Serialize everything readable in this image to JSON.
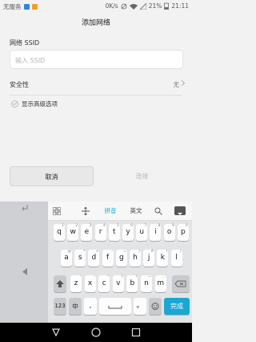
{
  "status": {
    "carrier": "无服务",
    "speed": "0K/s",
    "battery": "21%",
    "time": "21:11",
    "icons": [
      "sim-icon",
      "notification-icon",
      "mute-icon",
      "wifi-icon",
      "no-signal-icon",
      "battery-icon"
    ]
  },
  "page": {
    "title": "添加网络"
  },
  "ssid": {
    "label": "网络 SSID",
    "placeholder": "输入 SSID",
    "value": ""
  },
  "security": {
    "label": "安全性",
    "value": "无"
  },
  "advanced": {
    "label": "显示高级选项"
  },
  "buttons": {
    "cancel": "取消",
    "connect": "连接"
  },
  "keyboard": {
    "toolbar": {
      "pinyin": "拼音",
      "english": "英文"
    },
    "row1": [
      {
        "k": "q",
        "s": "1"
      },
      {
        "k": "w",
        "s": "2"
      },
      {
        "k": "e",
        "s": "3"
      },
      {
        "k": "r",
        "s": "4"
      },
      {
        "k": "t",
        "s": "5"
      },
      {
        "k": "y",
        "s": "6"
      },
      {
        "k": "u",
        "s": "7"
      },
      {
        "k": "i",
        "s": "8"
      },
      {
        "k": "o",
        "s": "9"
      },
      {
        "k": "p",
        "s": "0"
      }
    ],
    "row2": [
      {
        "k": "a",
        "s": "@"
      },
      {
        "k": "s",
        "s": "*"
      },
      {
        "k": "d",
        "s": "+"
      },
      {
        "k": "f",
        "s": "-"
      },
      {
        "k": "g",
        "s": "="
      },
      {
        "k": "h",
        "s": "/"
      },
      {
        "k": "j",
        "s": "#"
      },
      {
        "k": "k",
        "s": "("
      },
      {
        "k": "l",
        "s": ")"
      }
    ],
    "row3": [
      {
        "k": "z",
        "s": "'"
      },
      {
        "k": "x",
        "s": ":"
      },
      {
        "k": "c",
        "s": "\""
      },
      {
        "k": "v",
        "s": "?"
      },
      {
        "k": "b",
        "s": "!"
      },
      {
        "k": "n",
        "s": "~"
      },
      {
        "k": "m",
        "s": "…"
      }
    ],
    "bottom": {
      "num": "123",
      "lang": "中",
      "comma": ",",
      "period": "。",
      "done": "完成"
    }
  },
  "colors": {
    "accent": "#1aa7d2",
    "done_key": "#1aa7d2",
    "background": "#f2f2f2"
  }
}
